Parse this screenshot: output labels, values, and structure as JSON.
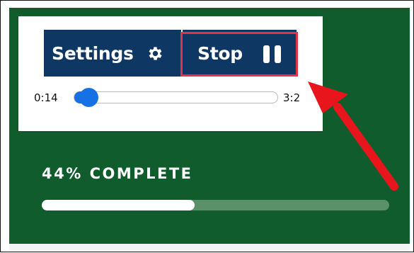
{
  "player": {
    "settings_label": "Settings",
    "settings_icon": "gear-icon",
    "stop_label": "Stop",
    "stop_icon": "pause-icon",
    "current_time": "0:14",
    "total_time": "3:2",
    "playback_fraction": 0.07
  },
  "course": {
    "progress_text": "44% COMPLETE",
    "progress_fraction": 0.44
  },
  "colors": {
    "panel_green": "#115c2c",
    "button_navy": "#0f3763",
    "slider_blue": "#1672e4",
    "highlight_red": "#e03545",
    "arrow_red": "#e8161c"
  }
}
